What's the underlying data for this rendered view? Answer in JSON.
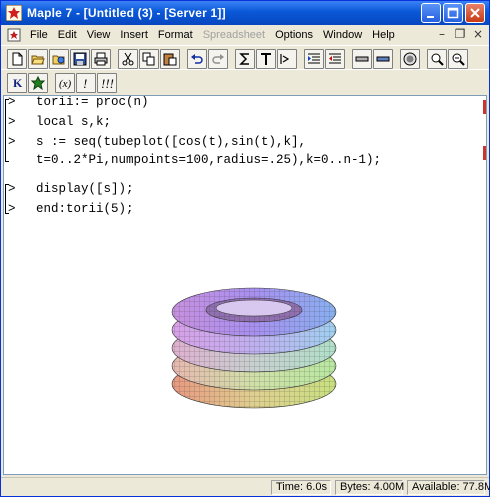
{
  "window": {
    "title": "Maple 7 - [Untitled (3) - [Server 1]]"
  },
  "menubar": {
    "items": [
      {
        "label": "File",
        "enabled": true
      },
      {
        "label": "Edit",
        "enabled": true
      },
      {
        "label": "View",
        "enabled": true
      },
      {
        "label": "Insert",
        "enabled": true
      },
      {
        "label": "Format",
        "enabled": true
      },
      {
        "label": "Spreadsheet",
        "enabled": false
      },
      {
        "label": "Options",
        "enabled": true
      },
      {
        "label": "Window",
        "enabled": true
      },
      {
        "label": "Help",
        "enabled": true
      }
    ]
  },
  "toolbar1": {
    "buttons": [
      "new-icon",
      "open-icon",
      "open-url-icon",
      "save-icon",
      "print-icon",
      "cut-icon",
      "copy-icon",
      "paste-icon",
      "undo-icon",
      "redo-icon",
      "sigma-icon",
      "text-icon",
      "prompt-icon",
      "indent-icon",
      "outdent-icon",
      "collapse-icon",
      "expand-icon",
      "stop-icon",
      "zoom-in-icon",
      "zoom-out-icon"
    ]
  },
  "toolbar2": {
    "buttons": [
      "k-icon",
      "maple-leaf-icon",
      "function-icon",
      "exclamation-icon",
      "multi-exclamation-icon"
    ]
  },
  "worksheet": {
    "prompt_symbol": ">",
    "lines": [
      {
        "prompt": true,
        "text": "torii:= proc(n)"
      },
      {
        "prompt": true,
        "text": "local s,k;"
      },
      {
        "prompt": true,
        "text": "s := seq(tubeplot([cos(t),sin(t),k],"
      },
      {
        "prompt": false,
        "text": "t=0..2*Pi,numpoints=100,radius=.25),k=0..n-1);"
      },
      {
        "prompt": true,
        "text": "display([s]);"
      },
      {
        "prompt": true,
        "text": "end:torii(5);"
      }
    ]
  },
  "statusbar": {
    "time": "Time: 6.0s",
    "bytes": "Bytes: 4.00M",
    "available": "Available: 77.8M"
  },
  "colors": {
    "titlebar": "#0a58d8",
    "chrome": "#ece9d8",
    "accent_red": "#cc3333"
  }
}
